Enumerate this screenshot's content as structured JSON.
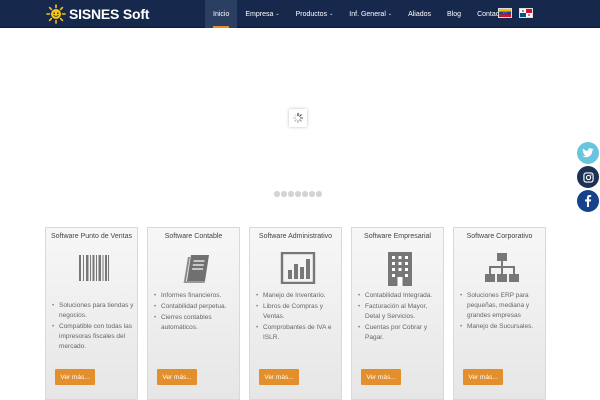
{
  "logo": {
    "text_main": "SISNES",
    "text_soft": "Soft"
  },
  "nav": [
    {
      "label": "Inicio",
      "caret": ""
    },
    {
      "label": "Empresa",
      "caret": "⌄"
    },
    {
      "label": "Productos",
      "caret": "⌄"
    },
    {
      "label": "Inf. General",
      "caret": "⌄"
    },
    {
      "label": "Aliados",
      "caret": ""
    },
    {
      "label": "Blog",
      "caret": ""
    },
    {
      "label": "Contacto",
      "caret": ""
    }
  ],
  "social": {
    "twitter": "twitter-icon",
    "instagram": "instagram-icon",
    "facebook": "facebook-icon"
  },
  "cards": [
    {
      "title": "Software Punto de Ventas",
      "icon": "barcode-icon",
      "items": [
        "Soluciones para tiendas y negocios.",
        "Compatible con todas las impresoras fiscales del mercado."
      ],
      "button": "Ver más..."
    },
    {
      "title": "Software Contable",
      "icon": "book-icon",
      "items": [
        "Informes financieros.",
        "Contabilidad perpetua.",
        "Cierres contables automáticos."
      ],
      "button": "Ver más..."
    },
    {
      "title": "Software Administrativo",
      "icon": "chart-icon",
      "items": [
        "Manejo de Inventario.",
        "Libros de Compras y Ventas.",
        "Comprobantes de IVA e ISLR."
      ],
      "button": "Ver más..."
    },
    {
      "title": "Software Empresarial",
      "icon": "building-icon",
      "items": [
        "Contabilidad Integrada.",
        "Facturación al Mayor, Detal y Servicios.",
        "Cuentas por Cobrar y Pagar."
      ],
      "button": "Ver más..."
    },
    {
      "title": "Software Corporativo",
      "icon": "network-icon",
      "items": [
        "Soluciones ERP para pequeñas, mediana y grandes empresas",
        "Manejo de Sucursales."
      ],
      "button": "Ver más..."
    }
  ],
  "colors": {
    "navbar": "#16294d",
    "accent": "#e38f2b",
    "twitter": "#69c5dd",
    "instagram": "#1c3156",
    "facebook": "#16418b"
  }
}
